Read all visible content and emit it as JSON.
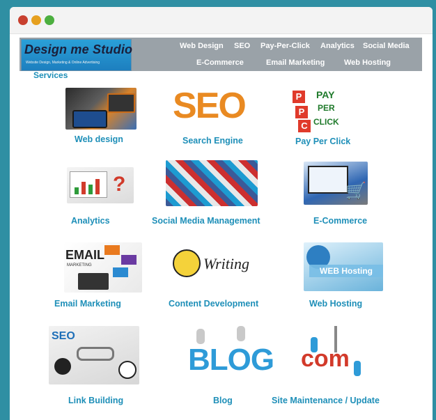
{
  "window": {
    "buttons": [
      "close",
      "minimize",
      "maximize"
    ]
  },
  "header": {
    "logo": {
      "brand": "Design me Studio",
      "tagline": "Website Design, Marketing & Online Advertising"
    },
    "nav_row1": [
      "Web Design",
      "SEO",
      "Pay-Per-Click",
      "Analytics",
      "Social Media"
    ],
    "nav_row2": [
      "E-Commerce",
      "Email Marketing",
      "Web Hosting"
    ]
  },
  "main": {
    "section_title": "Services",
    "services": [
      {
        "label": "Web design",
        "icon": "web-design-image"
      },
      {
        "label": "Search Engine",
        "icon": "seo-image"
      },
      {
        "label": "Pay Per Click",
        "icon": "ppc-image"
      },
      {
        "label": "Analytics",
        "icon": "analytics-image"
      },
      {
        "label": "Social Media Management",
        "icon": "social-media-image"
      },
      {
        "label": "E-Commerce",
        "icon": "ecommerce-image"
      },
      {
        "label": "Email Marketing",
        "icon": "email-marketing-image"
      },
      {
        "label": "Content Development",
        "icon": "content-development-image"
      },
      {
        "label": "Web Hosting",
        "icon": "web-hosting-image"
      },
      {
        "label": "Link Building",
        "icon": "link-building-image"
      },
      {
        "label": "Blog",
        "icon": "blog-image"
      },
      {
        "label": "Site Maintenance / Update",
        "icon": "site-maintenance-image"
      }
    ],
    "image_texts": {
      "seo": "SEO",
      "ppc": [
        "PAY",
        "PER",
        "CLICK"
      ],
      "email": [
        "EMAIL",
        "MARKETING"
      ],
      "content": "Writing",
      "hosting": "WEB Hosting",
      "blog": "BLOG",
      "site": "com"
    }
  },
  "colors": {
    "background": "#2f8fa3",
    "link": "#1e8fb8",
    "header_bar": "#9aa2a8"
  }
}
